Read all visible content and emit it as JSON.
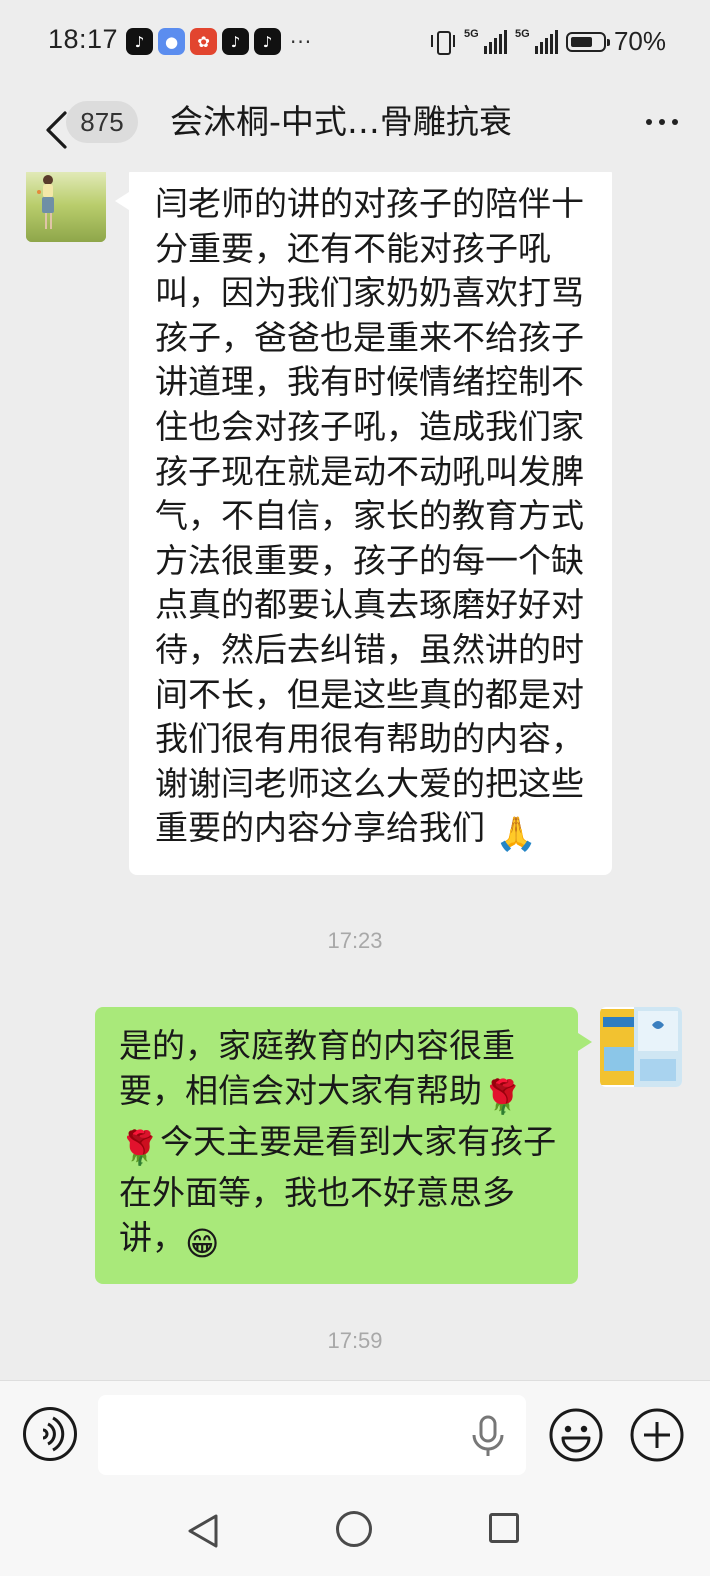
{
  "status_bar": {
    "time": "18:17",
    "network_1": "5G",
    "network_2": "5G",
    "battery_percent": "70%",
    "battery_level": 0.7,
    "notification_icons": [
      "tiktok-icon",
      "messages-icon",
      "red-app-icon",
      "tiktok-icon",
      "tiktok-icon"
    ]
  },
  "header": {
    "back_icon": "chevron-left-icon",
    "unread_count": "875",
    "title": "会沐桐-中式…骨雕抗衰",
    "menu_icon": "more-dots-icon"
  },
  "messages": [
    {
      "side": "left",
      "text": "闫老师的讲的对孩子的陪伴十分重要，还有不能对孩子吼叫，因为我们家奶奶喜欢打骂孩子，爸爸也是重来不给孩子讲道理，我有时候情绪控制不住也会对孩子吼，造成我们家孩子现在就是动不动吼叫发脾气，不自信，家长的教育方式方法很重要，孩子的每一个缺点真的都要认真去琢磨好好对待，然后去纠错，虽然讲的时间不长，但是这些真的都是对我们很有用很有帮助的内容，谢谢闫老师这么大爱的把这些重要的内容分享给我们",
      "trailing_emoji": "🙏"
    },
    {
      "side": "right",
      "text_part1": "是的，家庭教育的内容很重要，相信会对大家有帮助",
      "emoji_1": "🌹",
      "emoji_2": "🌹",
      "text_part2": "今天主要是看到大家有孩子在外面等，我也不好意思多讲，",
      "emoji_3": "😁"
    }
  ],
  "timestamps": [
    "17:23",
    "17:59"
  ],
  "input_bar": {
    "voice_icon": "voice-input-icon",
    "text_value": "",
    "mic_icon": "microphone-icon",
    "emoji_icon": "emoji-icon",
    "plus_icon": "plus-icon"
  },
  "nav_bar": {
    "icons": [
      "nav-back-icon",
      "nav-home-icon",
      "nav-recents-icon"
    ]
  }
}
